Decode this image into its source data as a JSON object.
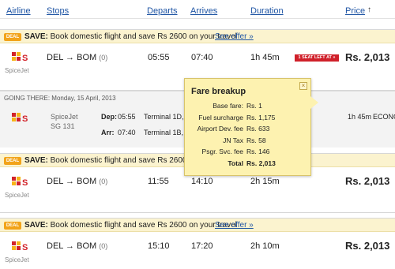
{
  "header": {
    "airline": "Airline",
    "stops": "Stops",
    "departs": "Departs",
    "arrives": "Arrives",
    "duration": "Duration",
    "price": "Price",
    "sort_arrow": "↑"
  },
  "promo": {
    "deal_badge": "DEAL",
    "save_label": "SAVE:",
    "text": "Book domestic flight and save Rs 2600 on your travel",
    "link": "See offer »"
  },
  "flights": [
    {
      "airline": "SpiceJet",
      "route": "DEL → BOM",
      "stops": "(0)",
      "departs": "05:55",
      "arrives": "07:40",
      "duration": "1h 45m",
      "price": "Rs. 2,013",
      "badge": "1 SEAT LEFT AT »"
    },
    {
      "airline": "SpiceJet",
      "route": "DEL → BOM",
      "stops": "(0)",
      "departs": "11:55",
      "arrives": "14:10",
      "duration": "2h 15m",
      "price": "Rs. 2,013"
    },
    {
      "airline": "SpiceJet",
      "route": "DEL → BOM",
      "stops": "(0)",
      "departs": "15:10",
      "arrives": "17:20",
      "duration": "2h 10m",
      "price": "Rs. 2,013"
    }
  ],
  "details": {
    "going_there": "GOING THERE: Monday, 15 April, 2013",
    "airline": "SpiceJet",
    "flight_no": "SG 131",
    "dep_label": "Dep:",
    "dep_time": "05:55",
    "dep_terminal": "Terminal 1D,",
    "arr_label": "Arr:",
    "arr_time": "07:40",
    "arr_terminal": "Terminal 1B,",
    "duration": "1h 45m",
    "class": "ECONO"
  },
  "fare_breakup": {
    "title": "Fare breakup",
    "rows": [
      {
        "label": "Base fare:",
        "value": "Rs. 1"
      },
      {
        "label": "Fuel surcharge",
        "value": "Rs. 1,175"
      },
      {
        "label": "Airport Dev. fee",
        "value": "Rs. 633"
      },
      {
        "label": "JN Tax",
        "value": "Rs. 58"
      },
      {
        "label": "Psgr. Svc. fee",
        "value": "Rs. 146"
      }
    ],
    "total_label": "Total",
    "total_value": "Rs. 2,013",
    "close": "×"
  },
  "colors": {
    "link": "#1f55a4",
    "promo_bg": "#fbf3cf",
    "deal_badge": "#f2a319",
    "seat_badge": "#d0202a",
    "popup_bg": "#fdf2b0",
    "spicejet_red": "#d2232a",
    "spicejet_yellow": "#f7b417"
  }
}
